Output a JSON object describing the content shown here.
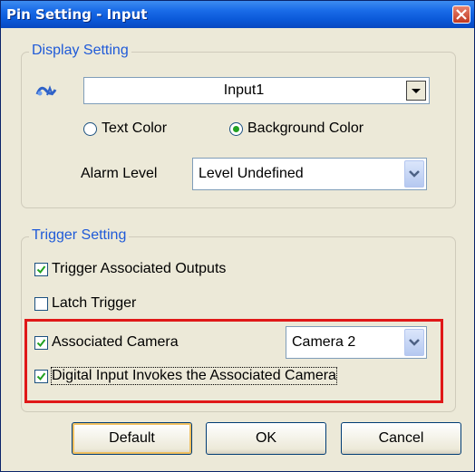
{
  "window": {
    "title": "Pin Setting - Input"
  },
  "display_setting": {
    "legend": "Display Setting",
    "pin_icon": "pin-signal-icon",
    "pin_name": "Input1",
    "text_color_label": "Text Color",
    "background_color_label": "Background Color",
    "selected_color_option": "Background Color",
    "alarm_level_label": "Alarm Level",
    "alarm_level_value": "Level Undefined"
  },
  "trigger_setting": {
    "legend": "Trigger Setting",
    "trigger_outputs_label": "Trigger Associated Outputs",
    "trigger_outputs_checked": true,
    "latch_trigger_label": "Latch Trigger",
    "latch_trigger_checked": false,
    "associated_camera_label": "Associated Camera",
    "associated_camera_checked": true,
    "camera_value": "Camera 2",
    "digital_input_label": "Digital Input Invokes the Associated Camera",
    "digital_input_checked": true
  },
  "buttons": {
    "default": "Default",
    "ok": "OK",
    "cancel": "Cancel"
  },
  "colors": {
    "title_blue": "#0a58d8",
    "legend_blue": "#1f5ad8",
    "highlight_red": "#e01818",
    "radio_green": "#21a121"
  }
}
